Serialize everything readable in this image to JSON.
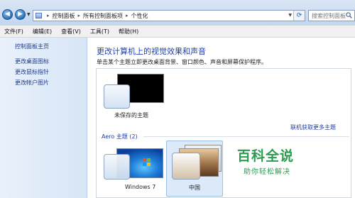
{
  "address": {
    "crumbs": [
      "控制面板",
      "所有控制面板项",
      "个性化"
    ]
  },
  "search": {
    "placeholder": "搜索控制面板"
  },
  "menu": [
    "文件(F)",
    "编辑(E)",
    "查看(V)",
    "工具(T)",
    "帮助(H)"
  ],
  "sidebar": {
    "home": "控制面板主页",
    "links": [
      "更改桌面图标",
      "更改鼠标指针",
      "更改帐户图片"
    ]
  },
  "main": {
    "heading": "更改计算机上的视觉效果和声音",
    "subtext": "单击某个主题立即更改桌面背景、窗口颜色、声音和屏幕保护程序。",
    "unsaved_theme": "未保存的主题",
    "get_more_online": "联机获取更多主题",
    "aero_heading": "Aero 主题 (2)",
    "themes": [
      "Windows 7",
      "中国"
    ]
  },
  "watermark": {
    "title": "百科全说",
    "subtitle": "助你轻松解决"
  },
  "colors": {
    "link": "#1e3ea6",
    "heading": "#1e3ea6",
    "watermark": "#2b9b4f",
    "selected_theme": "#dbe9f8"
  }
}
